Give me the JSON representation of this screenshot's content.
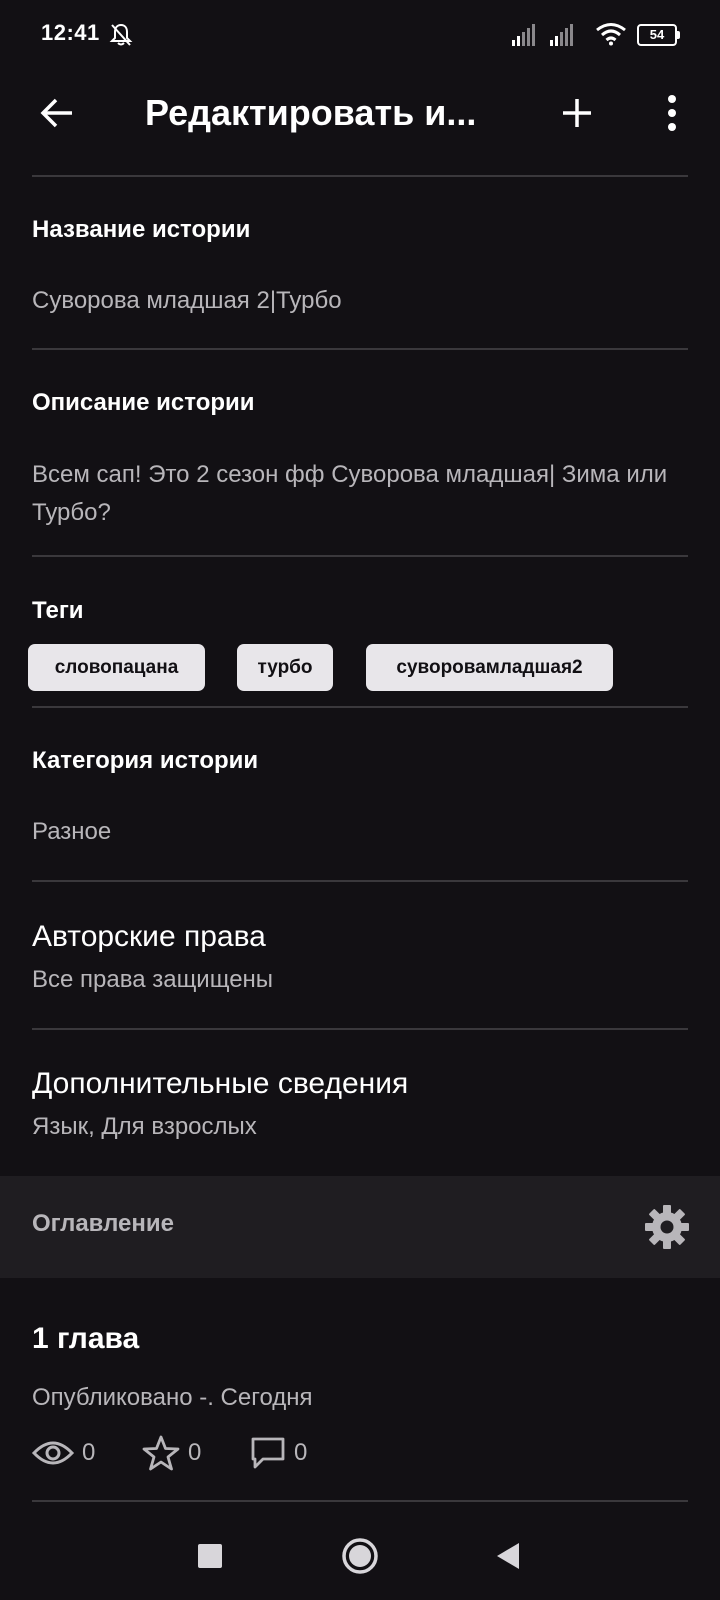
{
  "status_bar": {
    "time": "12:41",
    "battery": "54",
    "icons": [
      "bell-off-icon",
      "signal-icon",
      "signal-icon",
      "wifi-icon",
      "battery-icon"
    ]
  },
  "app_bar": {
    "title": "Редактировать и...",
    "icons": [
      "arrow-back-icon",
      "plus-icon",
      "more-vertical-icon"
    ]
  },
  "story": {
    "title_label": "Название истории",
    "title_value": "Суворова младшая 2|Турбо",
    "description_label": "Описание истории",
    "description_value": "Всем сап! Это 2 сезон фф Суворова младшая| Зима или Турбо?",
    "tags_label": "Теги",
    "tags": [
      "словопацана",
      "турбо",
      "суворовамладшая2"
    ],
    "category_label": "Категория истории",
    "category_value": "Разное",
    "copyright_label": "Авторские права",
    "copyright_value": "Все права защищены",
    "extra_label": "Дополнительные сведения",
    "extra_value": "Язык, Для взрослых"
  },
  "toc": {
    "label": "Оглавление",
    "icon": "gear-icon"
  },
  "chapter": {
    "title": "1 глава",
    "meta": "Опубликовано -. Сегодня",
    "views": "0",
    "votes": "0",
    "comments": "0"
  },
  "colors": {
    "background": "#121014",
    "divider": "#3a383c",
    "secondary_text": "#b8b6ba",
    "tag_bg": "#e8e6ea",
    "toc_bg": "#1f1d21"
  }
}
